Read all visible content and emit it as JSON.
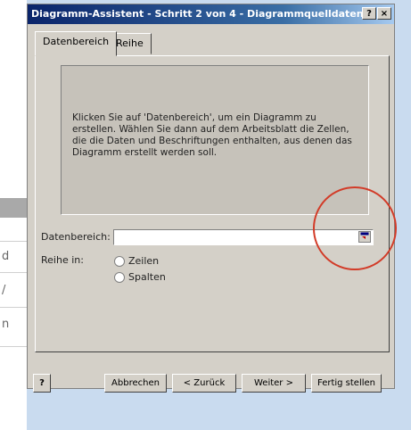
{
  "dialog": {
    "title": "Diagramm-Assistent - Schritt 2 von 4 - Diagrammquelldaten",
    "help_glyph": "?",
    "close_glyph": "×"
  },
  "tabs": [
    {
      "label": "Datenbereich",
      "active": true
    },
    {
      "label": "Reihe",
      "active": false
    }
  ],
  "preview": {
    "text": "Klicken Sie auf 'Datenbereich', um ein Diagramm zu erstellen. Wählen Sie dann auf dem Arbeitsblatt die Zellen, die die Daten und Beschriftungen enthalten, aus denen das Diagramm erstellt werden soll."
  },
  "range": {
    "label": "Datenbereich:",
    "value": "",
    "collapse_icon": "collapse-dialog-icon"
  },
  "series_in": {
    "label": "Reihe in:",
    "options": [
      "Zeilen",
      "Spalten"
    ],
    "selected": null
  },
  "buttons": {
    "help": "?",
    "cancel": "Abbrechen",
    "back": "< Zurück",
    "next": "Weiter >",
    "finish": "Fertig stellen"
  },
  "background_sheet": {
    "chars": [
      "d",
      "/",
      "n"
    ]
  },
  "colors": {
    "title_start": "#0a246a",
    "title_end": "#a6caf0",
    "annotation": "#d23b28"
  }
}
